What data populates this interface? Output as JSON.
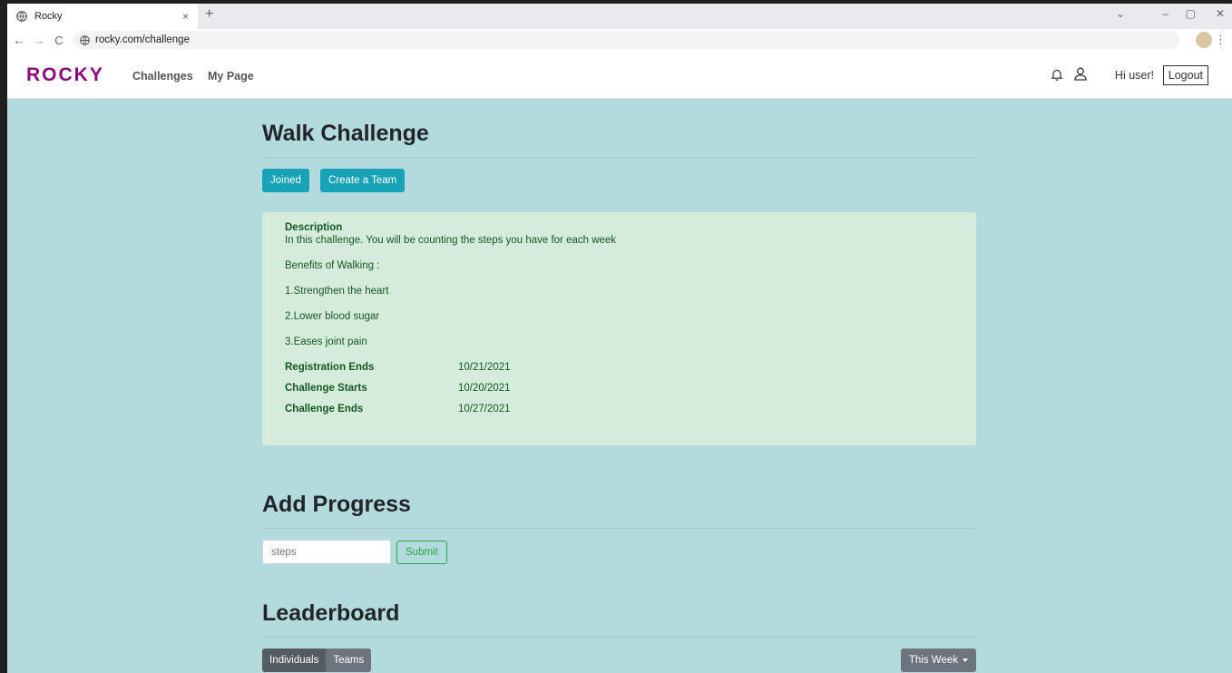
{
  "browser": {
    "tab_title": "Rocky",
    "tab_close": "×",
    "new_tab": "+",
    "url": "rocky.com/challenge",
    "controls": {
      "minimize": "–",
      "restore": "▢",
      "close": "✕",
      "tabs_menu": "⌄"
    }
  },
  "site": {
    "brand": "ROCKY",
    "nav": {
      "challenges": "Challenges",
      "my_page": "My Page"
    },
    "greeting": "Hi user!",
    "logout": "Logout"
  },
  "challenge": {
    "title": "Walk Challenge",
    "joined_label": "Joined",
    "create_team_label": "Create a Team",
    "description_heading": "Description",
    "description_text": "In this challenge. You will be counting the steps you have for each week",
    "benefits_heading": "Benefits of Walking :",
    "benefits": [
      "1.Strengthen the heart",
      "2.Lower blood sugar",
      "3.Eases joint pain"
    ],
    "dates": [
      {
        "label": "Registration Ends",
        "value": "10/21/2021"
      },
      {
        "label": "Challenge Starts",
        "value": "10/20/2021"
      },
      {
        "label": "Challenge Ends",
        "value": "10/27/2021"
      }
    ]
  },
  "progress": {
    "title": "Add Progress",
    "placeholder": "steps",
    "submit_label": "Submit"
  },
  "leaderboard": {
    "title": "Leaderboard",
    "tabs": [
      "Individuals",
      "Teams"
    ],
    "period_label": "This Week"
  },
  "colors": {
    "brand": "#8b0a7c",
    "page_bg": "#b3dbdd",
    "teal": "#17a2b8",
    "success": "#28a745",
    "panel": "#d4ecd9"
  }
}
